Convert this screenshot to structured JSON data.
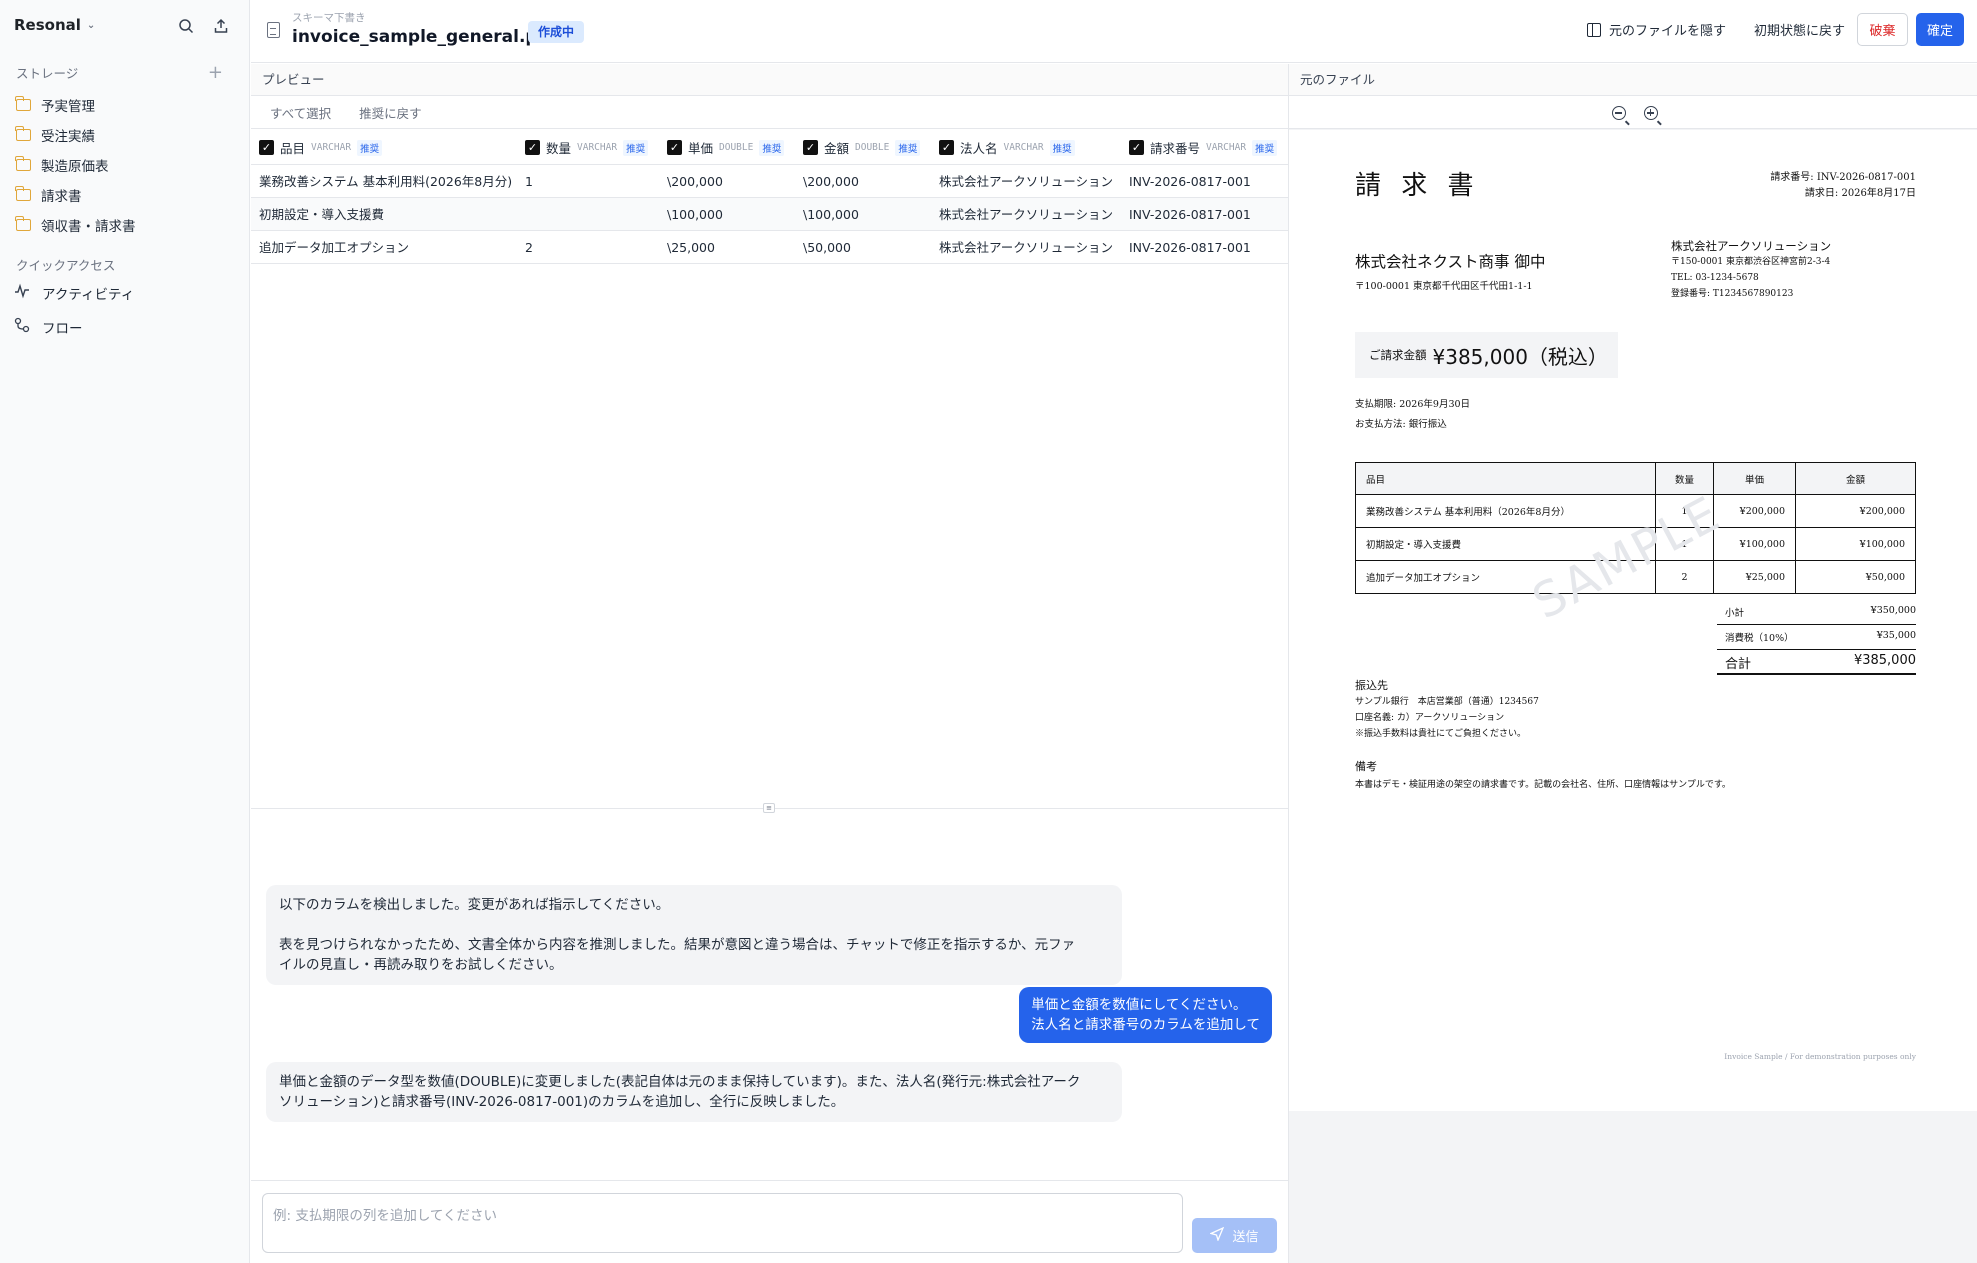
{
  "sidebar": {
    "brand": "Resonal",
    "storage_title": "ストレージ",
    "storage_items": [
      "予実管理",
      "受注実績",
      "製造原価表",
      "請求書",
      "領収書・請求書"
    ],
    "quick_title": "クイックアクセス",
    "quick_items": [
      {
        "label": "アクティビティ",
        "icon": "activity-icon"
      },
      {
        "label": "フロー",
        "icon": "flow-icon"
      }
    ]
  },
  "topbar": {
    "draft_label": "スキーマ下書き",
    "file_name": "invoice_sample_general.pdf",
    "status": "作成中",
    "hide_original": "元のファイルを隠す",
    "reset": "初期状態に戻す",
    "discard": "破棄",
    "confirm": "確定"
  },
  "preview": {
    "title": "プレビュー",
    "select_all": "すべて選択",
    "reset_recommended": "推奨に戻す",
    "columns": [
      {
        "name": "品目",
        "type": "VARCHAR",
        "badge": "推奨"
      },
      {
        "name": "数量",
        "type": "VARCHAR",
        "badge": "推奨"
      },
      {
        "name": "単価",
        "type": "DOUBLE",
        "badge": "推奨"
      },
      {
        "name": "金額",
        "type": "DOUBLE",
        "badge": "推奨"
      },
      {
        "name": "法人名",
        "type": "VARCHAR",
        "badge": "推奨"
      },
      {
        "name": "請求番号",
        "type": "VARCHAR",
        "badge": "推奨"
      }
    ],
    "rows": [
      [
        "業務改善システム 基本利用料(2026年8月分)",
        "1",
        "\\200,000",
        "\\200,000",
        "株式会社アークソリューション",
        "INV-2026-0817-001"
      ],
      [
        "初期設定・導入支援費",
        "",
        "\\100,000",
        "\\100,000",
        "株式会社アークソリューション",
        "INV-2026-0817-001"
      ],
      [
        "追加データ加工オプション",
        "2",
        "\\25,000",
        "\\50,000",
        "株式会社アークソリューション",
        "INV-2026-0817-001"
      ]
    ]
  },
  "chat": {
    "messages": [
      {
        "role": "bot",
        "lines": [
          "以下のカラムを検出しました。変更があれば指示してください。",
          "",
          "表を見つけられなかったため、文書全体から内容を推測しました。結果が意図と違う場合は、チャットで修正を指示するか、元ファ",
          "イルの見直し・再読み取りをお試しください。"
        ]
      },
      {
        "role": "user",
        "lines": [
          "単価と金額を数値にしてください。",
          "法人名と請求番号のカラムを追加して"
        ]
      },
      {
        "role": "bot",
        "lines": [
          "単価と金額のデータ型を数値(DOUBLE)に変更しました(表記自体は元のまま保持しています)。また、法人名(発行元:株式会社アーク",
          "ソリューション)と請求番号(INV-2026-0817-001)のカラムを追加し、全行に反映しました。"
        ]
      }
    ],
    "placeholder": "例: 支払期限の列を追加してください",
    "send": "送信"
  },
  "original": {
    "title": "元のファイル",
    "doc": {
      "heading": "請 求 書",
      "invoice_no": "請求番号: INV-2026-0817-001",
      "invoice_date": "請求日: 2026年8月17日",
      "customer": "株式会社ネクスト商事 御中",
      "customer_addr": "〒100-0001 東京都千代田区千代田1-1-1",
      "issuer_name": "株式会社アークソリューション",
      "issuer_addr": "〒150-0001 東京都渋谷区神宮前2-3-4",
      "issuer_tel": "TEL: 03-1234-5678",
      "issuer_reg": "登録番号: T1234567890123",
      "amount_label": "ご請求金額",
      "amount_value": "¥385,000（税込）",
      "due": "支払期限: 2026年9月30日",
      "method": "お支払方法: 銀行振込",
      "table_headers": [
        "品目",
        "数量",
        "単価",
        "金額"
      ],
      "table_rows": [
        [
          "業務改善システム 基本利用料（2026年8月分）",
          "1",
          "¥200,000",
          "¥200,000"
        ],
        [
          "初期設定・導入支援費",
          "1",
          "¥100,000",
          "¥100,000"
        ],
        [
          "追加データ加工オプション",
          "2",
          "¥25,000",
          "¥50,000"
        ]
      ],
      "subtotal_label": "小計",
      "subtotal": "¥350,000",
      "tax_label": "消費税（10%）",
      "tax": "¥35,000",
      "total_label": "合計",
      "total": "¥385,000",
      "watermark": "SAMPLE",
      "bank_title": "振込先",
      "bank_lines": [
        "サンプル銀行　本店営業部（普通）1234567",
        "口座名義: カ）アークソリューション",
        "※振込手数料は貴社にてご負担ください。"
      ],
      "notes_title": "備考",
      "notes": "本書はデモ・検証用途の架空の請求書です。記載の会社名、住所、口座情報はサンプルです。",
      "footer": "Invoice Sample / For demonstration purposes only"
    }
  }
}
